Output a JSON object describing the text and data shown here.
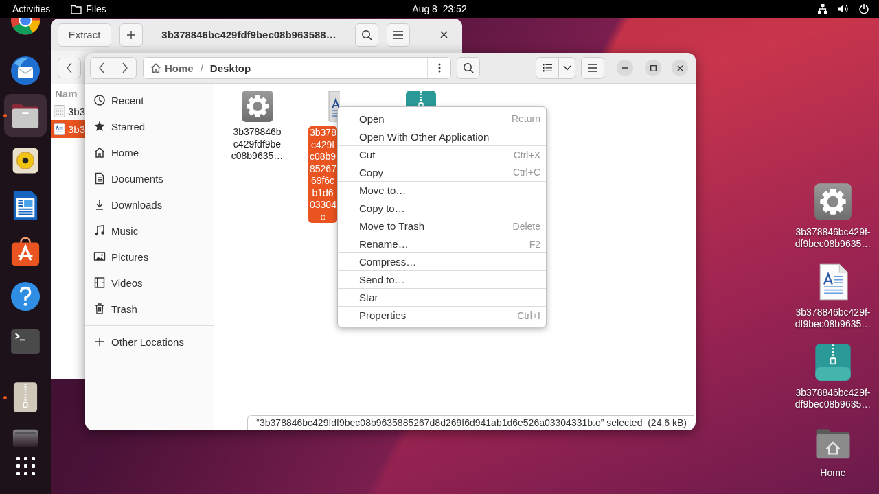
{
  "top_bar": {
    "activities": "Activities",
    "app_name": "Files",
    "clock": "Aug 8  23:52"
  },
  "dock": [
    {
      "kind": "browser",
      "running": false,
      "focused": false
    },
    {
      "kind": "mail",
      "running": false,
      "focused": false
    },
    {
      "kind": "files",
      "running": true,
      "focused": true
    },
    {
      "kind": "music",
      "running": false,
      "focused": false
    },
    {
      "kind": "writer",
      "running": false,
      "focused": false
    },
    {
      "kind": "store",
      "running": false,
      "focused": false
    },
    {
      "kind": "help",
      "running": false,
      "focused": false
    },
    {
      "kind": "terminal",
      "running": false,
      "focused": false
    },
    {
      "kind": "archive",
      "running": true,
      "focused": false
    },
    {
      "kind": "drive",
      "running": false,
      "focused": false
    },
    {
      "kind": "apps",
      "running": false,
      "focused": false
    }
  ],
  "archive_window": {
    "extract_button": "Extract",
    "title": "3b378846bc429fdf9bec08b963588…",
    "column_1": "Nam",
    "rows": [
      {
        "kind": "binary",
        "name": "3b3",
        "selected": false
      },
      {
        "kind": "document",
        "name": "3b3",
        "selected": true
      }
    ]
  },
  "files_window": {
    "path": [
      "Home",
      "Desktop"
    ],
    "path_separator": "/",
    "sidebar": [
      {
        "kind": "recent",
        "label": "Recent"
      },
      {
        "kind": "starred",
        "label": "Starred"
      },
      {
        "kind": "home",
        "label": "Home"
      },
      {
        "kind": "documents",
        "label": "Documents"
      },
      {
        "kind": "downloads",
        "label": "Downloads"
      },
      {
        "kind": "music",
        "label": "Music"
      },
      {
        "kind": "pictures",
        "label": "Pictures"
      },
      {
        "kind": "videos",
        "label": "Videos"
      },
      {
        "kind": "trash",
        "label": "Trash"
      }
    ],
    "other_locations": "Other Locations",
    "items": [
      {
        "kind": "executable",
        "label_lines": [
          "3b378846b",
          "c429fdf9be",
          "c08b9635…"
        ],
        "selected": false
      },
      {
        "kind": "document",
        "label_lines": [
          "3b378",
          "c429f",
          "c08b9",
          "85267",
          "69f6c",
          "b1d6",
          "03304",
          "c"
        ],
        "selected": true
      },
      {
        "kind": "archive",
        "selected": false
      }
    ],
    "status": "“3b378846bc429fdf9bec08b9635885267d8d269f6d941ab1d6e526a03304331b.o” selected  (24.6 kB)"
  },
  "context_menu": [
    {
      "label": "Open",
      "shortcut": "Return",
      "separator_before": false
    },
    {
      "label": "Open With Other Application",
      "separator_before": false
    },
    {
      "label": "Cut",
      "shortcut": "Ctrl+X",
      "separator_before": true
    },
    {
      "label": "Copy",
      "shortcut": "Ctrl+C",
      "separator_before": false
    },
    {
      "label": "Move to…",
      "separator_before": true
    },
    {
      "label": "Copy to…",
      "separator_before": false
    },
    {
      "label": "Move to Trash",
      "shortcut": "Delete",
      "separator_before": true
    },
    {
      "label": "Rename…",
      "shortcut": "F2",
      "separator_before": true
    },
    {
      "label": "Compress…",
      "separator_before": true
    },
    {
      "label": "Send to…",
      "separator_before": true
    },
    {
      "label": "Star",
      "separator_before": true
    },
    {
      "label": "Properties",
      "shortcut": "Ctrl+I",
      "separator_before": true
    }
  ],
  "desktop_icons": [
    {
      "kind": "executable",
      "label_lines": [
        "3b378846bc429f-",
        "df9bec08b9635…"
      ]
    },
    {
      "kind": "document",
      "label_lines": [
        "3b378846bc429f-",
        "df9bec08b9635…"
      ]
    },
    {
      "kind": "archive",
      "label_lines": [
        "3b378846bc429f-",
        "df9bec08b9635…"
      ]
    },
    {
      "kind": "home",
      "label_lines": [
        "Home"
      ]
    }
  ]
}
